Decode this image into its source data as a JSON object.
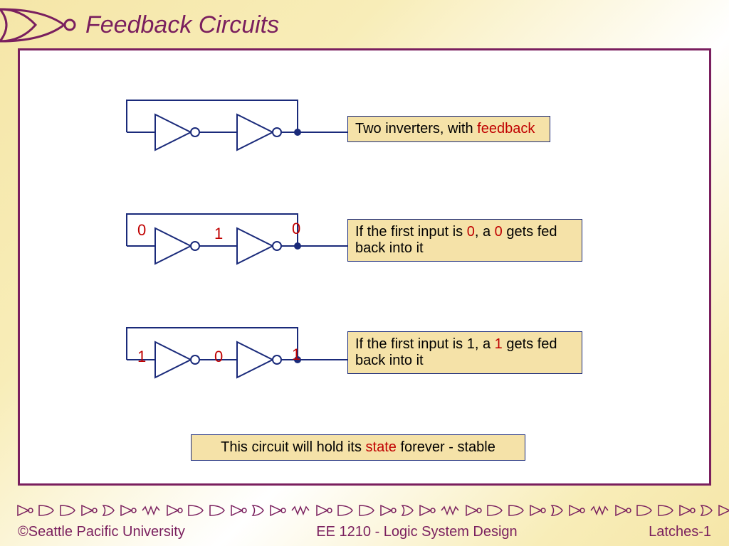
{
  "title": "Feedback Circuits",
  "box1": {
    "prefix": "Two inverters, with ",
    "red": "feedback"
  },
  "box2": {
    "p1": "If the first input is ",
    "r1": "0",
    "p2": ", a ",
    "r2": "0",
    "p3": " gets fed back into it"
  },
  "box3": {
    "p1": "If the first input is 1, a ",
    "r1": "1",
    "p2": " gets fed back into it"
  },
  "box4": {
    "p1": "This circuit will hold its ",
    "r1": "state",
    "p2": " forever - stable"
  },
  "diag2": {
    "in": "0",
    "mid": "1",
    "out": "0"
  },
  "diag3": {
    "in": "1",
    "mid": "0",
    "out": "1"
  },
  "footer": {
    "left": "©Seattle Pacific University",
    "center": "EE 1210 - Logic System Design",
    "right": "Latches-1"
  }
}
